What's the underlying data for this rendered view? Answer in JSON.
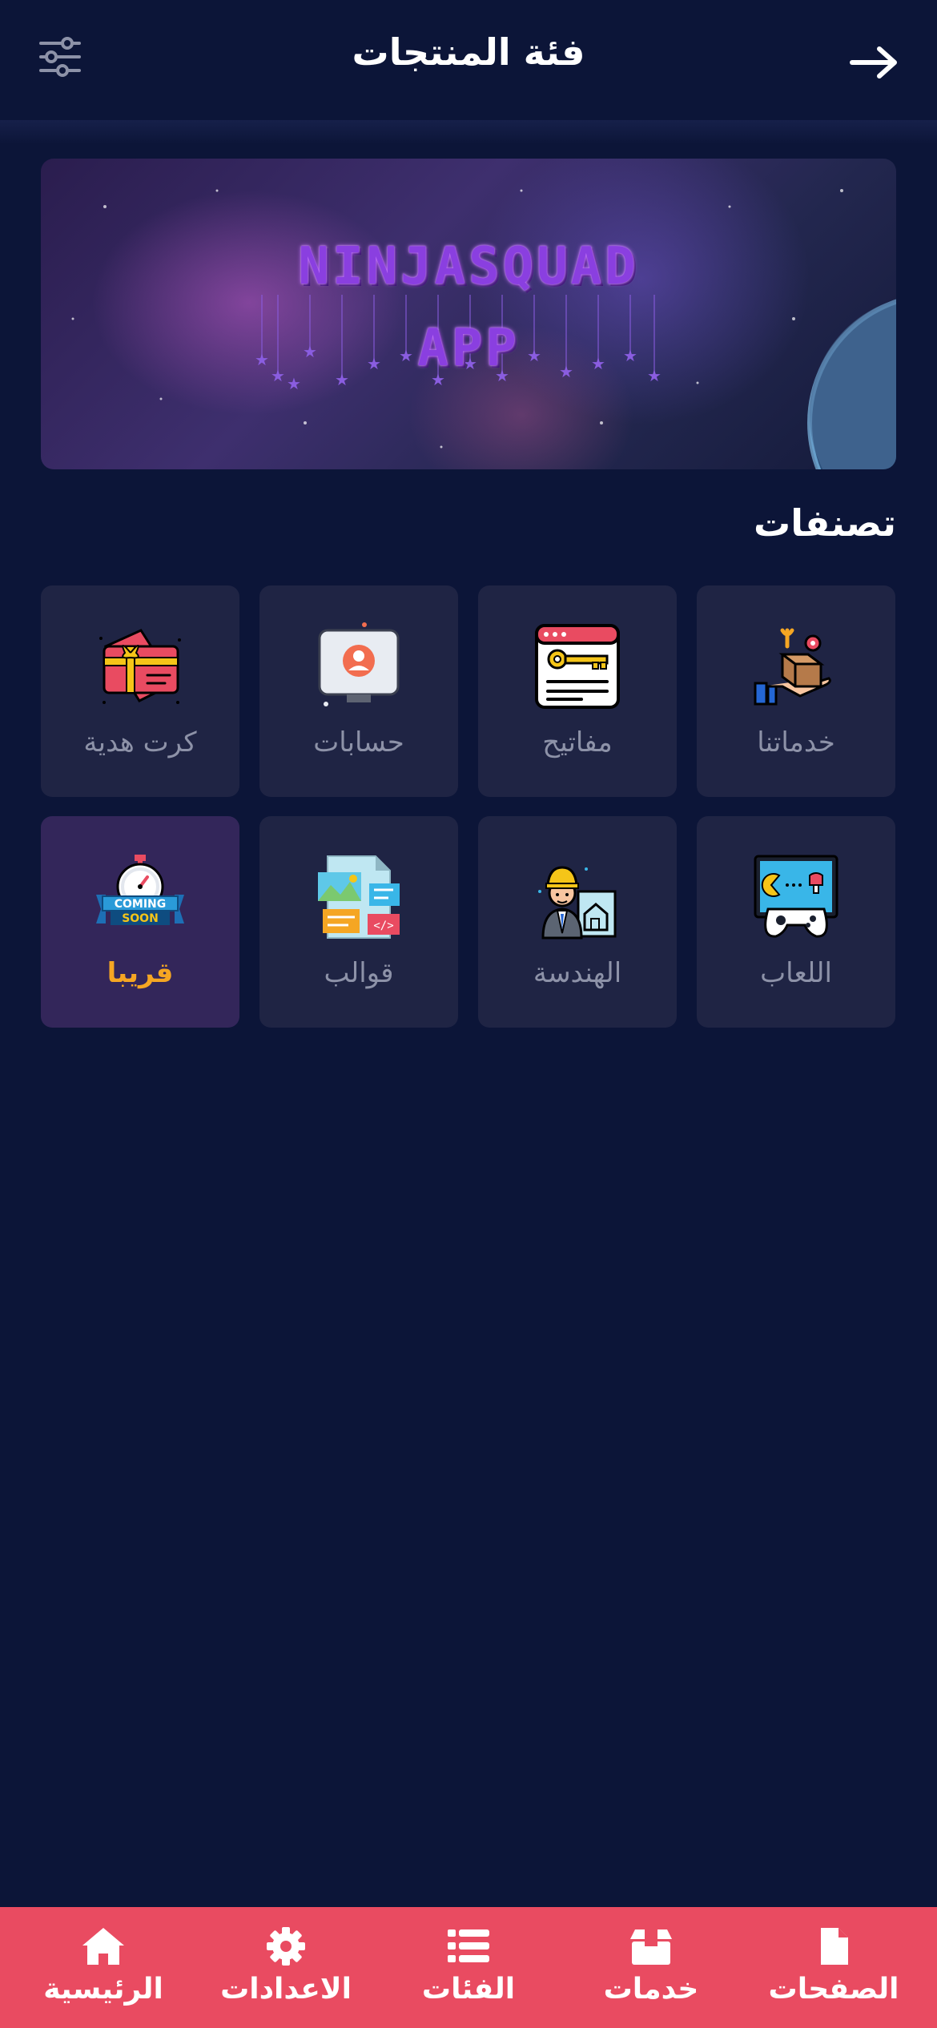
{
  "header": {
    "title": "فئة المنتجات"
  },
  "banner": {
    "line1": "NINJASQUAD",
    "line2": "APP"
  },
  "section": {
    "title": "تصنفات"
  },
  "categories": [
    {
      "label": "خدماتنا",
      "icon": "services-icon"
    },
    {
      "label": "مفاتيح",
      "icon": "keys-icon"
    },
    {
      "label": "حسابات",
      "icon": "accounts-icon"
    },
    {
      "label": "كرت هدية",
      "icon": "gift-card-icon"
    },
    {
      "label": "اللعاب",
      "icon": "games-icon"
    },
    {
      "label": "الهندسة",
      "icon": "engineering-icon"
    },
    {
      "label": "قوالب",
      "icon": "templates-icon"
    },
    {
      "label": "قريبا",
      "icon": "coming-soon-icon",
      "badge_line1": "COMING",
      "badge_line2": "SOON"
    }
  ],
  "nav": [
    {
      "label": "الرئيسية",
      "icon": "home-icon"
    },
    {
      "label": "الاعدادات",
      "icon": "gear-icon"
    },
    {
      "label": "الفئات",
      "icon": "list-icon"
    },
    {
      "label": "خدمات",
      "icon": "box-icon"
    },
    {
      "label": "الصفحات",
      "icon": "page-icon"
    }
  ],
  "colors": {
    "background": "#0c1538",
    "tile": "#1f2444",
    "tile_soon": "#33265a",
    "accent_soon": "#f5a623",
    "nav_bar": "#e94b61"
  }
}
